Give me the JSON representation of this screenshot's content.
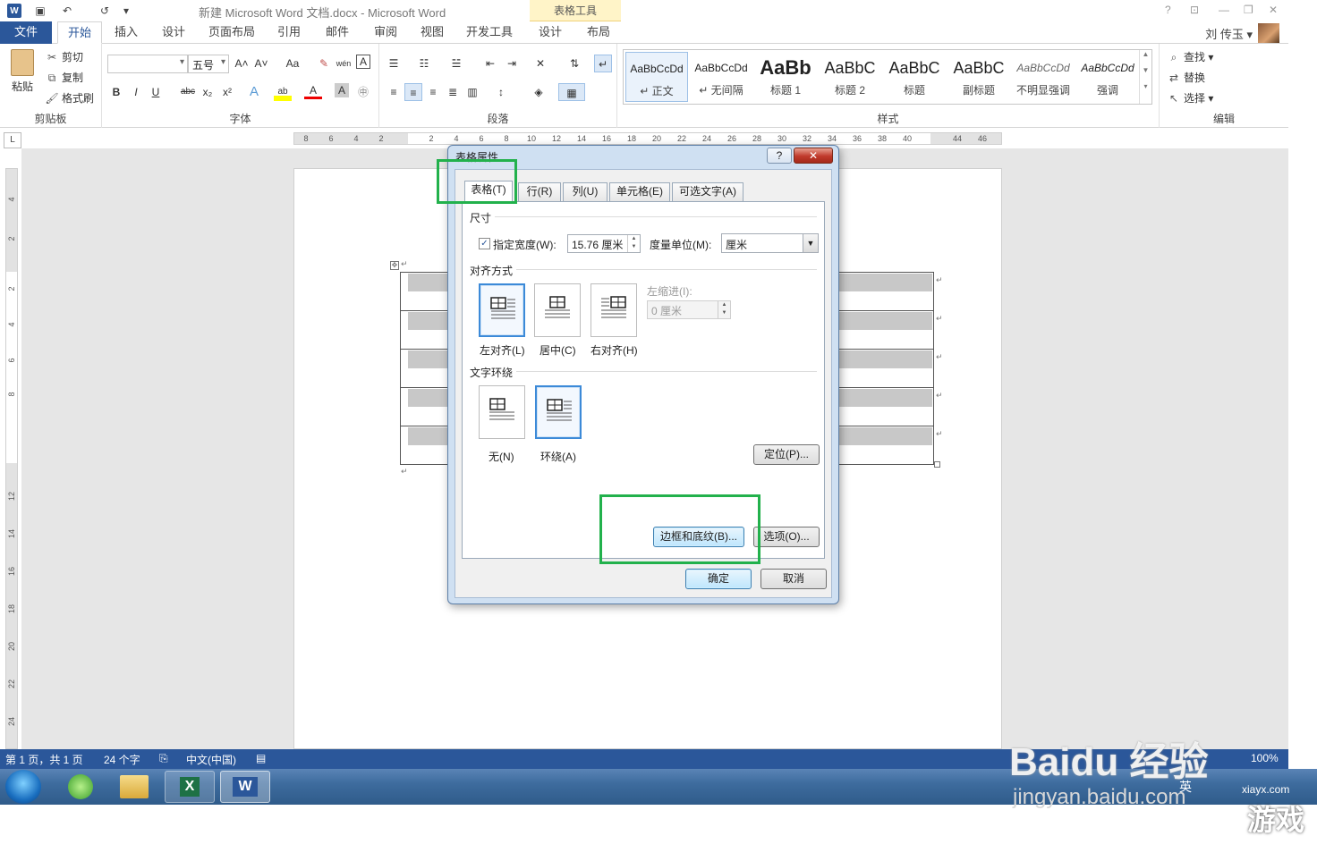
{
  "window": {
    "title": "新建 Microsoft Word 文档.docx - Microsoft Word",
    "contextual_tab_group": "表格工具",
    "help_glyph": "?",
    "restore_ribbon_glyph": "⊡",
    "minimize_glyph": "—",
    "maximize_glyph": "❐",
    "close_glyph": "✕"
  },
  "quick_access": {
    "word_logo": "W",
    "save_glyph": "▣",
    "undo_glyph": "↶",
    "redo_glyph": "↺",
    "customize_glyph": "▾"
  },
  "tabs": [
    "文件",
    "开始",
    "插入",
    "设计",
    "页面布局",
    "引用",
    "邮件",
    "审阅",
    "视图",
    "开发工具",
    "设计",
    "布局"
  ],
  "user": {
    "name": "刘 传玉 ▾"
  },
  "ribbon": {
    "clipboard": {
      "label": "剪贴板",
      "paste": "粘贴",
      "cut": "剪切",
      "copy": "复制",
      "format_painter": "格式刷"
    },
    "font": {
      "label": "字体",
      "font_name": "",
      "font_size": "五号",
      "grow": "A˄",
      "shrink": "A˅",
      "change_case": "Aa",
      "clear": "✎",
      "phonetic": "wén",
      "border_char": "A",
      "bold": "B",
      "italic": "I",
      "underline": "U",
      "strike": "abc",
      "subscript": "x₂",
      "superscript": "x²",
      "text_effects": "A",
      "highlight": "ab",
      "font_color": "A",
      "shading_char": "A",
      "enclose": "㊥"
    },
    "paragraph": {
      "label": "段落"
    },
    "styles": {
      "label": "样式",
      "items": [
        {
          "sample": "AaBbCcDd",
          "name": "↵ 正文"
        },
        {
          "sample": "AaBbCcDd",
          "name": "↵ 无间隔"
        },
        {
          "sample": "AaBb",
          "name": "标题 1"
        },
        {
          "sample": "AaBbC",
          "name": "标题 2"
        },
        {
          "sample": "AaBbC",
          "name": "标题"
        },
        {
          "sample": "AaBbC",
          "name": "副标题"
        },
        {
          "sample": "AaBbCcDd",
          "name": "不明显强调"
        },
        {
          "sample": "AaBbCcDd",
          "name": "强调"
        }
      ]
    },
    "editing": {
      "label": "编辑",
      "find": "查找 ▾",
      "replace": "替换",
      "select": "选择 ▾"
    }
  },
  "ruler": {
    "corner": "L",
    "h_ticks": [
      "8",
      "6",
      "4",
      "2",
      "2",
      "4",
      "6",
      "8",
      "10",
      "12",
      "14",
      "16",
      "18",
      "20",
      "22",
      "24",
      "26",
      "28",
      "30",
      "32",
      "34",
      "36",
      "38",
      "40",
      "44",
      "46"
    ],
    "v_ticks": [
      "4",
      "2",
      "2",
      "4",
      "6",
      "8",
      "12",
      "14",
      "16",
      "18",
      "20",
      "22",
      "24"
    ]
  },
  "document": {
    "paragraph_mark": "↵",
    "move_handle": "✥"
  },
  "dialog": {
    "title": "表格属性",
    "help": "?",
    "close": "✕",
    "tabs": [
      "表格(T)",
      "行(R)",
      "列(U)",
      "单元格(E)",
      "可选文字(A)"
    ],
    "size_section": "尺寸",
    "preferred_width_checked": "✓",
    "preferred_width_label": "指定宽度(W):",
    "preferred_width_value": "15.76 厘米",
    "measure_in_label": "度量单位(M):",
    "measure_in_value": "厘米",
    "alignment_section": "对齐方式",
    "align_left": "左对齐(L)",
    "align_center": "居中(C)",
    "align_right": "右对齐(H)",
    "indent_label": "左缩进(I):",
    "indent_value": "0 厘米",
    "wrapping_section": "文字环绕",
    "wrap_none": "无(N)",
    "wrap_around": "环绕(A)",
    "positioning_button": "定位(P)...",
    "borders_button": "边框和底纹(B)...",
    "options_button": "选项(O)...",
    "ok_button": "确定",
    "cancel_button": "取消"
  },
  "status": {
    "page": "第 1 页，共 1 页",
    "words": "24 个字",
    "language": "中文(中国)",
    "zoom": "100%"
  },
  "taskbar": {
    "excel": "X",
    "word": "W",
    "ime": "英"
  },
  "watermark": {
    "brand": "Baidu 经验",
    "url": "jingyan.baidu.com",
    "site": "xiayx.com",
    "game": "游戏"
  },
  "colors": {
    "accent": "#2b579a",
    "annotation": "#22b14c",
    "contextual": "#fff4c8"
  }
}
